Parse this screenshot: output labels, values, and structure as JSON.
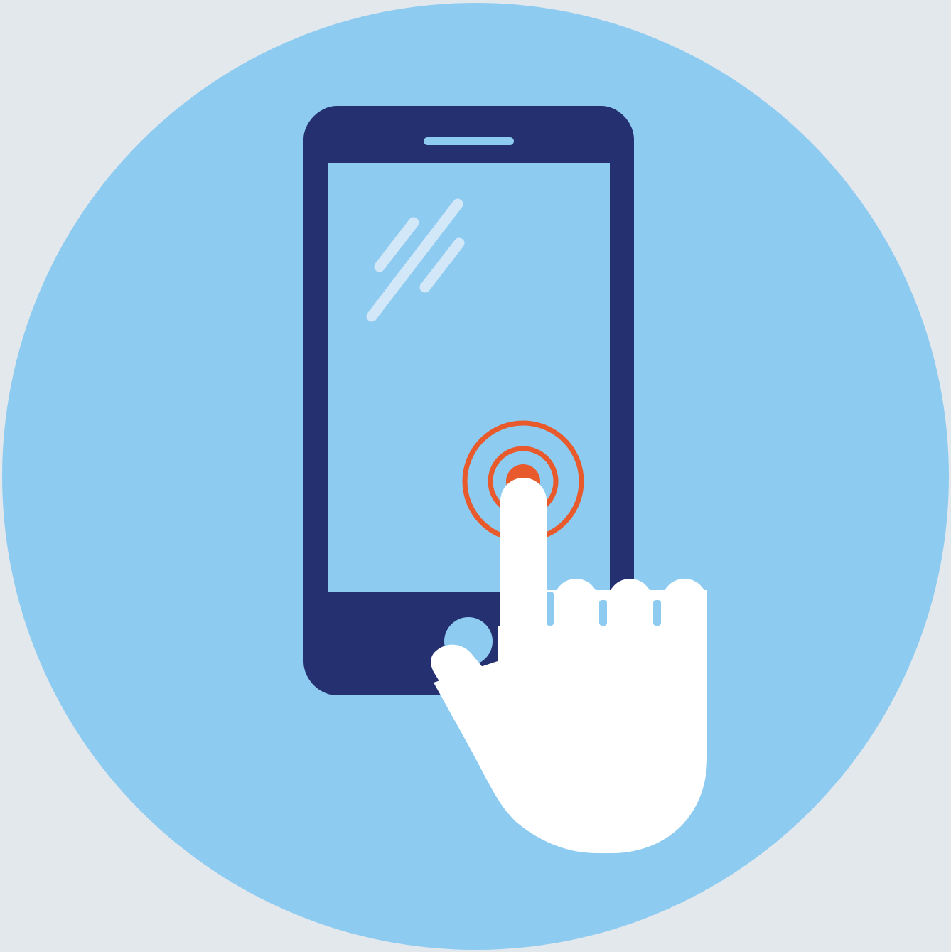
{
  "illustration": {
    "subject": "touchscreen-tap-icon",
    "colors": {
      "page_background": "#E3E8ED",
      "circle_background": "#8DCBF1",
      "phone_body": "#253071",
      "screen": "#8DCBF1",
      "glare": "#D2E7F7",
      "tap_ripple": "#E85A2C",
      "hand": "#FFFFFF"
    },
    "icons": [
      "smartphone-icon",
      "pointing-hand-icon",
      "tap-ripple-icon",
      "screen-glare-icon",
      "home-button-icon",
      "speaker-slot-icon"
    ]
  }
}
